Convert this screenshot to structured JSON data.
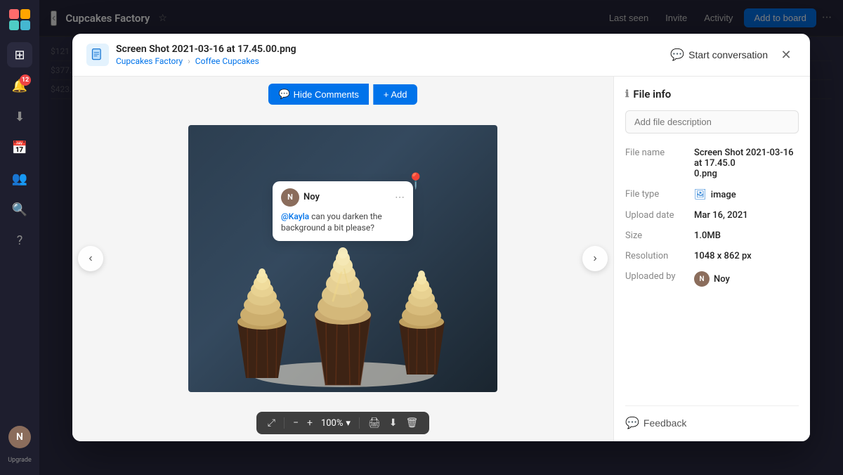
{
  "sidebar": {
    "logo_alt": "Monday.com logo",
    "badge_count": "12",
    "upgrade_label": "Upgrade",
    "avatar_initials": "N"
  },
  "topbar": {
    "back_label": "‹",
    "title": "Cupcakes Factory",
    "star_icon": "☆",
    "last_seen": "Last seen",
    "invite_label": "Invite",
    "activity_label": "Activity",
    "add_to_board_label": "Add to board",
    "more_icon": "···"
  },
  "modal": {
    "file_name": "Screen Shot 2021-03-16 at 17.45.00.png",
    "breadcrumb": {
      "parent": "Cupcakes Factory",
      "child": "Coffee Cupcakes",
      "sep": "›"
    },
    "start_conversation_label": "Start conversation",
    "close_icon": "✕",
    "hide_comments_label": "Hide Comments",
    "add_label": "+ Add",
    "comment": {
      "username": "Noy",
      "mention": "@Kayla",
      "text": " can you darken the background a bit please?"
    },
    "nav_left": "‹",
    "nav_right": "›",
    "zoom_value": "100%",
    "zoom_chevron": "▾"
  },
  "file_info": {
    "panel_title": "File info",
    "description_placeholder": "Add file description",
    "rows": [
      {
        "label": "File name",
        "value": "Screen Shot 2021-03-16 at 17.45.0\n0.png"
      },
      {
        "label": "File type",
        "value": "image"
      },
      {
        "label": "Upload date",
        "value": "Mar 16, 2021"
      },
      {
        "label": "Size",
        "value": "1.0MB"
      },
      {
        "label": "Resolution",
        "value": "1048 x 862 px"
      },
      {
        "label": "Uploaded by",
        "value": "Noy"
      }
    ],
    "feedback_label": "Feedback"
  }
}
